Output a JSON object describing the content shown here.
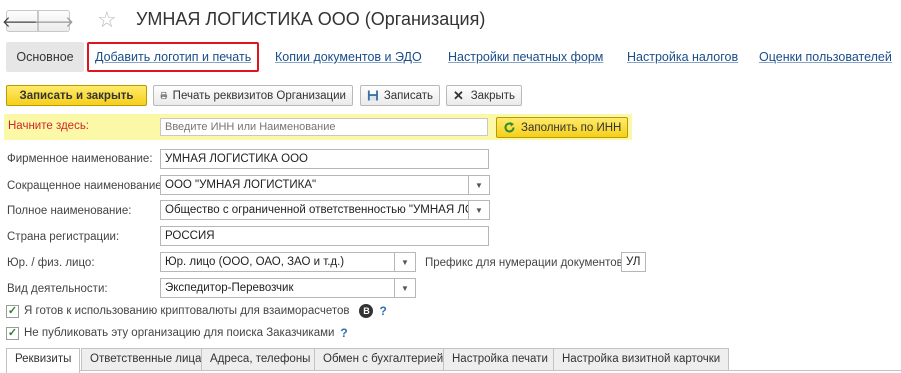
{
  "window": {
    "back_glyph": "🡐",
    "forward_glyph": "🡒",
    "title": "УМНАЯ ЛОГИСТИКА ООО (Организация)"
  },
  "sections": [
    {
      "label": "Основное"
    },
    {
      "label": "Добавить логотип и печать"
    },
    {
      "label": "Копии документов и ЭДО"
    },
    {
      "label": "Настройки печатных форм"
    },
    {
      "label": "Настройка налогов"
    },
    {
      "label": "Оценки пользователей"
    }
  ],
  "toolbar": {
    "save_close": "Записать и закрыть",
    "print_requisites": "Печать реквизитов Организации",
    "save": "Записать",
    "close": "Закрыть"
  },
  "start": {
    "label": "Начните здесь:",
    "placeholder": "Введите ИНН или Наименование",
    "fill_button": "Заполнить по ИНН"
  },
  "fields": {
    "brand_name_label": "Фирменное наименование:",
    "brand_name_value": "УМНАЯ ЛОГИСТИКА ООО",
    "short_name_label": "Сокращенное наименование:",
    "short_name_value": "ООО \"УМНАЯ ЛОГИСТИКА\"",
    "full_name_label": "Полное наименование:",
    "full_name_value": "Общество с ограниченной ответственностью \"УМНАЯ ЛОГИСТИКА\"",
    "country_label": "Страна регистрации:",
    "country_value": "РОССИЯ",
    "entity_type_label": "Юр. / физ. лицо:",
    "entity_type_value": "Юр. лицо (ООО, ОАО, ЗАО и т.д.)",
    "prefix_label": "Префикс для нумерации документов :",
    "prefix_value": "УЛ",
    "activity_label": "Вид деятельности:",
    "activity_value": "Экспедитор-Перевозчик"
  },
  "checkboxes": {
    "crypto_label": "Я готов к использованию криптовалюты для взаиморасчетов",
    "crypto_badge": "B",
    "publish_label": "Не публиковать эту организацию для поиска Заказчиками",
    "help_glyph": "?"
  },
  "tabs": [
    {
      "label": "Реквизиты"
    },
    {
      "label": "Ответственные лица"
    },
    {
      "label": "Адреса, телефоны"
    },
    {
      "label": "Обмен с бухгалтерией"
    },
    {
      "label": "Настройка печати"
    },
    {
      "label": "Настройка визитной карточки"
    }
  ],
  "colors": {
    "accent_yellow": "#f5cf1b",
    "start_strip": "#fbf8a8",
    "highlight_red": "#e0141e",
    "link_blue": "#1a4e8a"
  }
}
